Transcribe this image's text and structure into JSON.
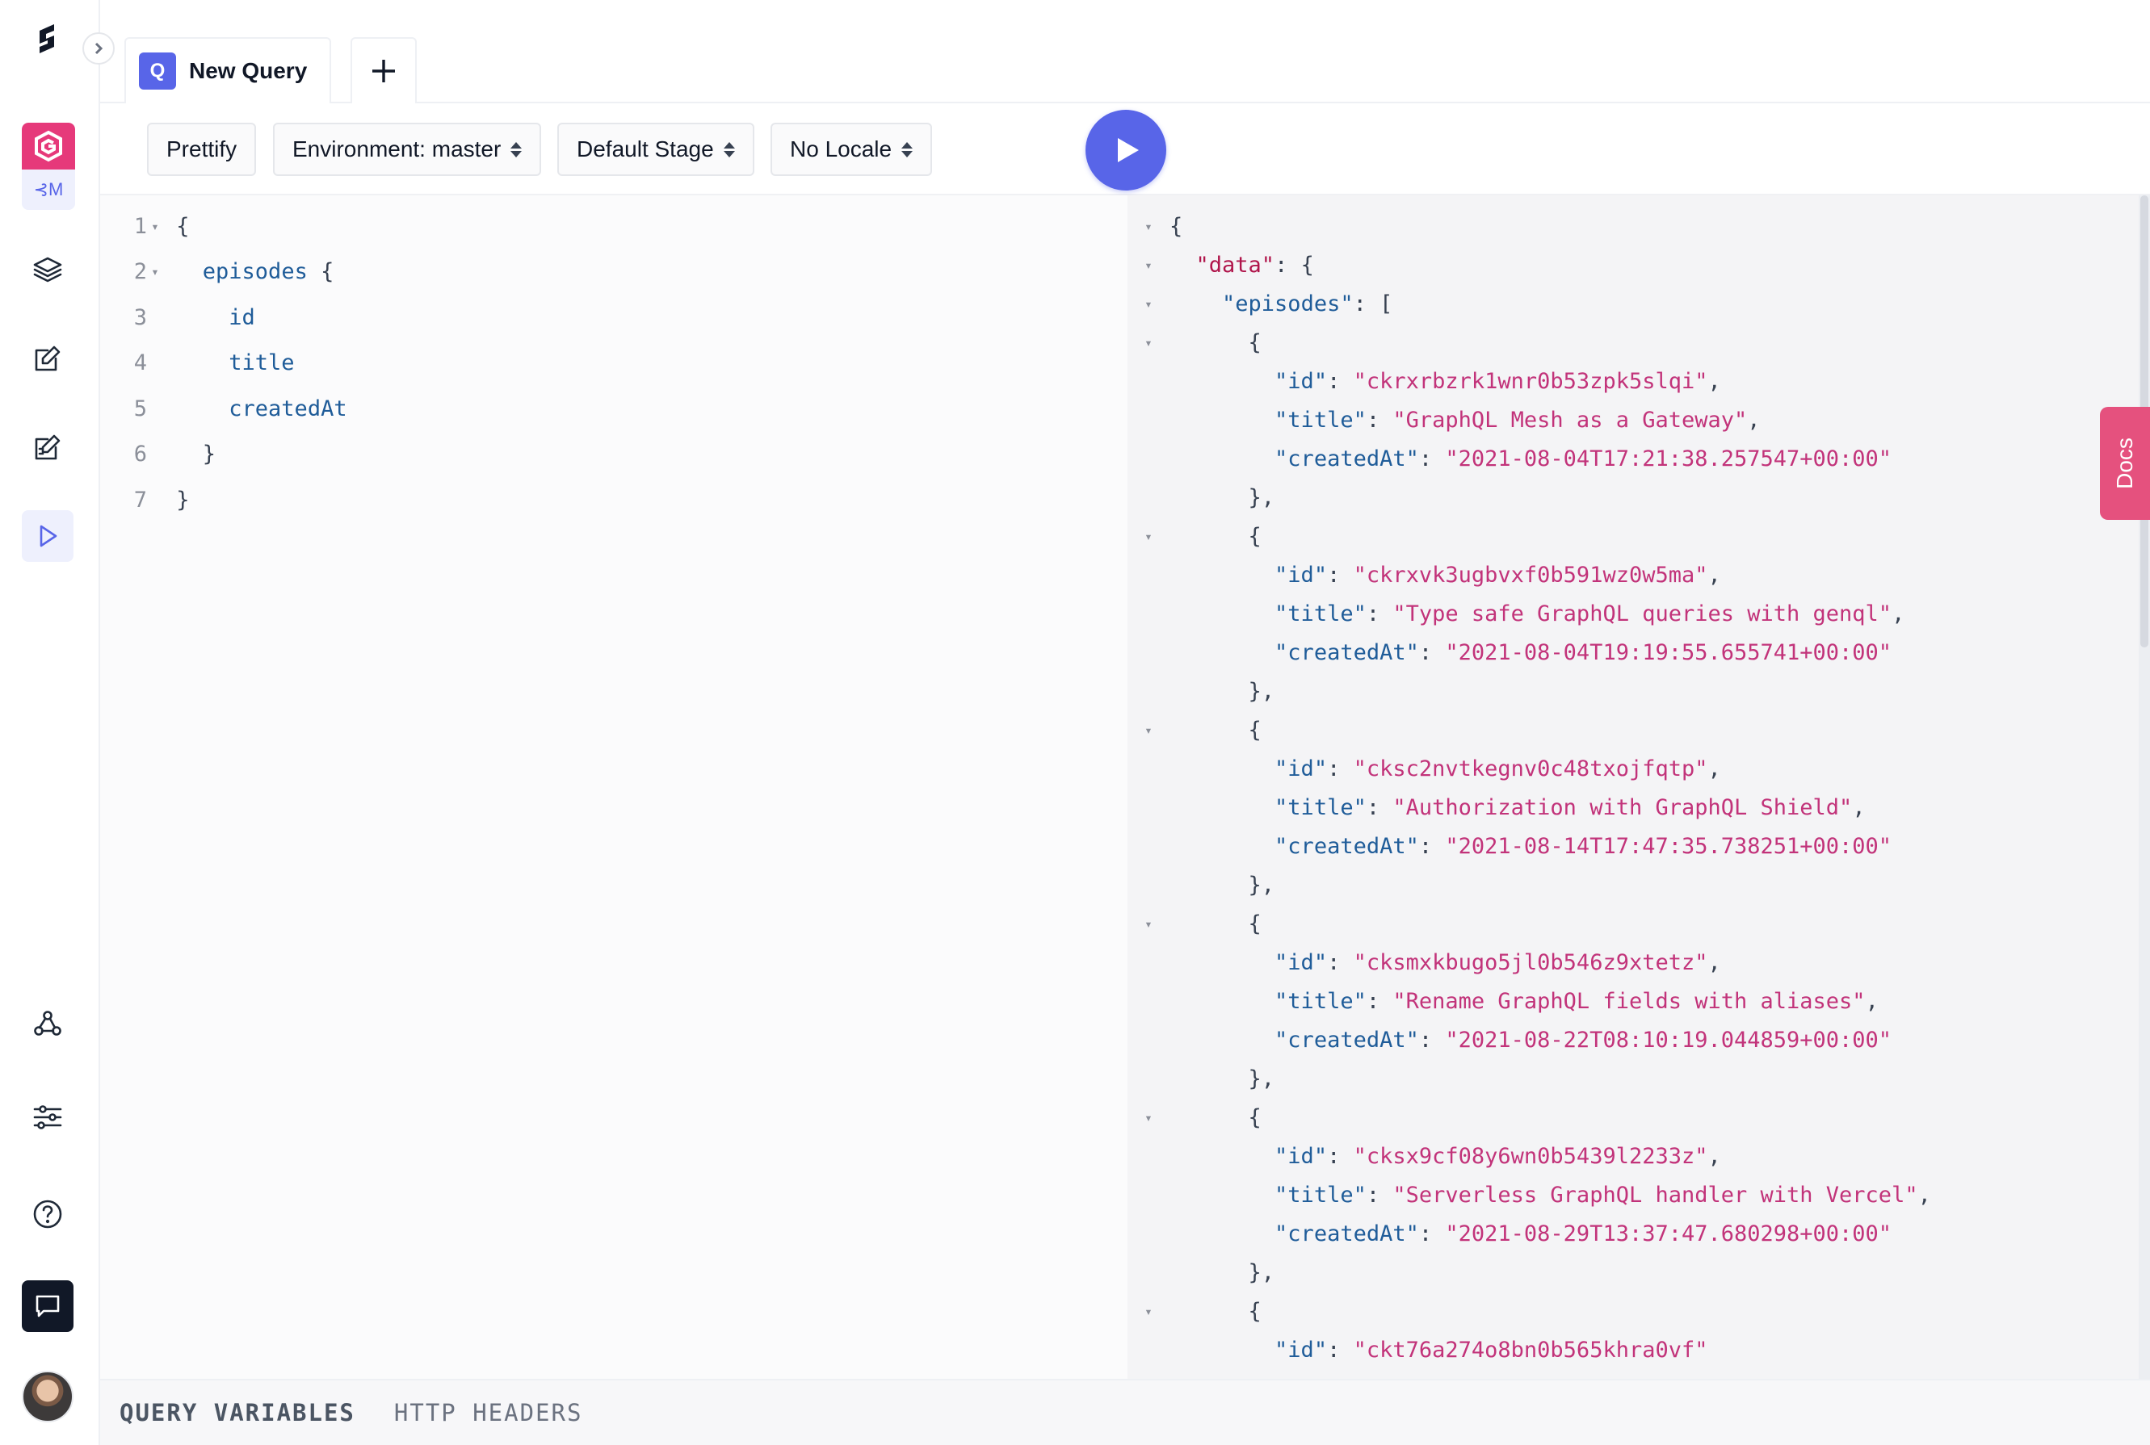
{
  "tabs": [
    {
      "badge": "Q",
      "label": "New Query"
    }
  ],
  "toolbar": {
    "prettify": "Prettify",
    "environment": "Environment: master",
    "stage": "Default Stage",
    "locale": "No Locale"
  },
  "sidebar": {
    "branch_label": "⊰M"
  },
  "query_lines": [
    {
      "n": "1",
      "fold": "▾",
      "indent": "",
      "text": "{",
      "field": false
    },
    {
      "n": "2",
      "fold": "▾",
      "indent": "  ",
      "text": "episodes",
      "suffix": " {",
      "field": true
    },
    {
      "n": "3",
      "fold": "",
      "indent": "    ",
      "text": "id",
      "field": true
    },
    {
      "n": "4",
      "fold": "",
      "indent": "    ",
      "text": "title",
      "field": true
    },
    {
      "n": "5",
      "fold": "",
      "indent": "    ",
      "text": "createdAt",
      "field": true
    },
    {
      "n": "6",
      "fold": "",
      "indent": "  ",
      "text": "}",
      "field": false
    },
    {
      "n": "7",
      "fold": "",
      "indent": "",
      "text": "}",
      "field": false
    }
  ],
  "episodes": [
    {
      "id": "ckrxrbzrk1wnr0b53zpk5slqi",
      "title": "GraphQL Mesh as a Gateway",
      "createdAt": "2021-08-04T17:21:38.257547+00:00"
    },
    {
      "id": "ckrxvk3ugbvxf0b591wz0w5ma",
      "title": "Type safe GraphQL queries with genql",
      "createdAt": "2021-08-04T19:19:55.655741+00:00"
    },
    {
      "id": "cksc2nvtkegnv0c48txojfqtp",
      "title": "Authorization with GraphQL Shield",
      "createdAt": "2021-08-14T17:47:35.738251+00:00"
    },
    {
      "id": "cksmxkbugo5jl0b546z9xtetz",
      "title": "Rename GraphQL fields with aliases",
      "createdAt": "2021-08-22T08:10:19.044859+00:00"
    },
    {
      "id": "cksx9cf08y6wn0b5439l2233z",
      "title": "Serverless GraphQL handler with Vercel",
      "createdAt": "2021-08-29T13:37:47.680298+00:00"
    },
    {
      "id": "ckt76a274o8bn0b565khra0vf",
      "title": "",
      "createdAt": ""
    }
  ],
  "docs_label": "Docs",
  "bottom_tabs": {
    "variables": "QUERY VARIABLES",
    "headers": "HTTP HEADERS"
  }
}
